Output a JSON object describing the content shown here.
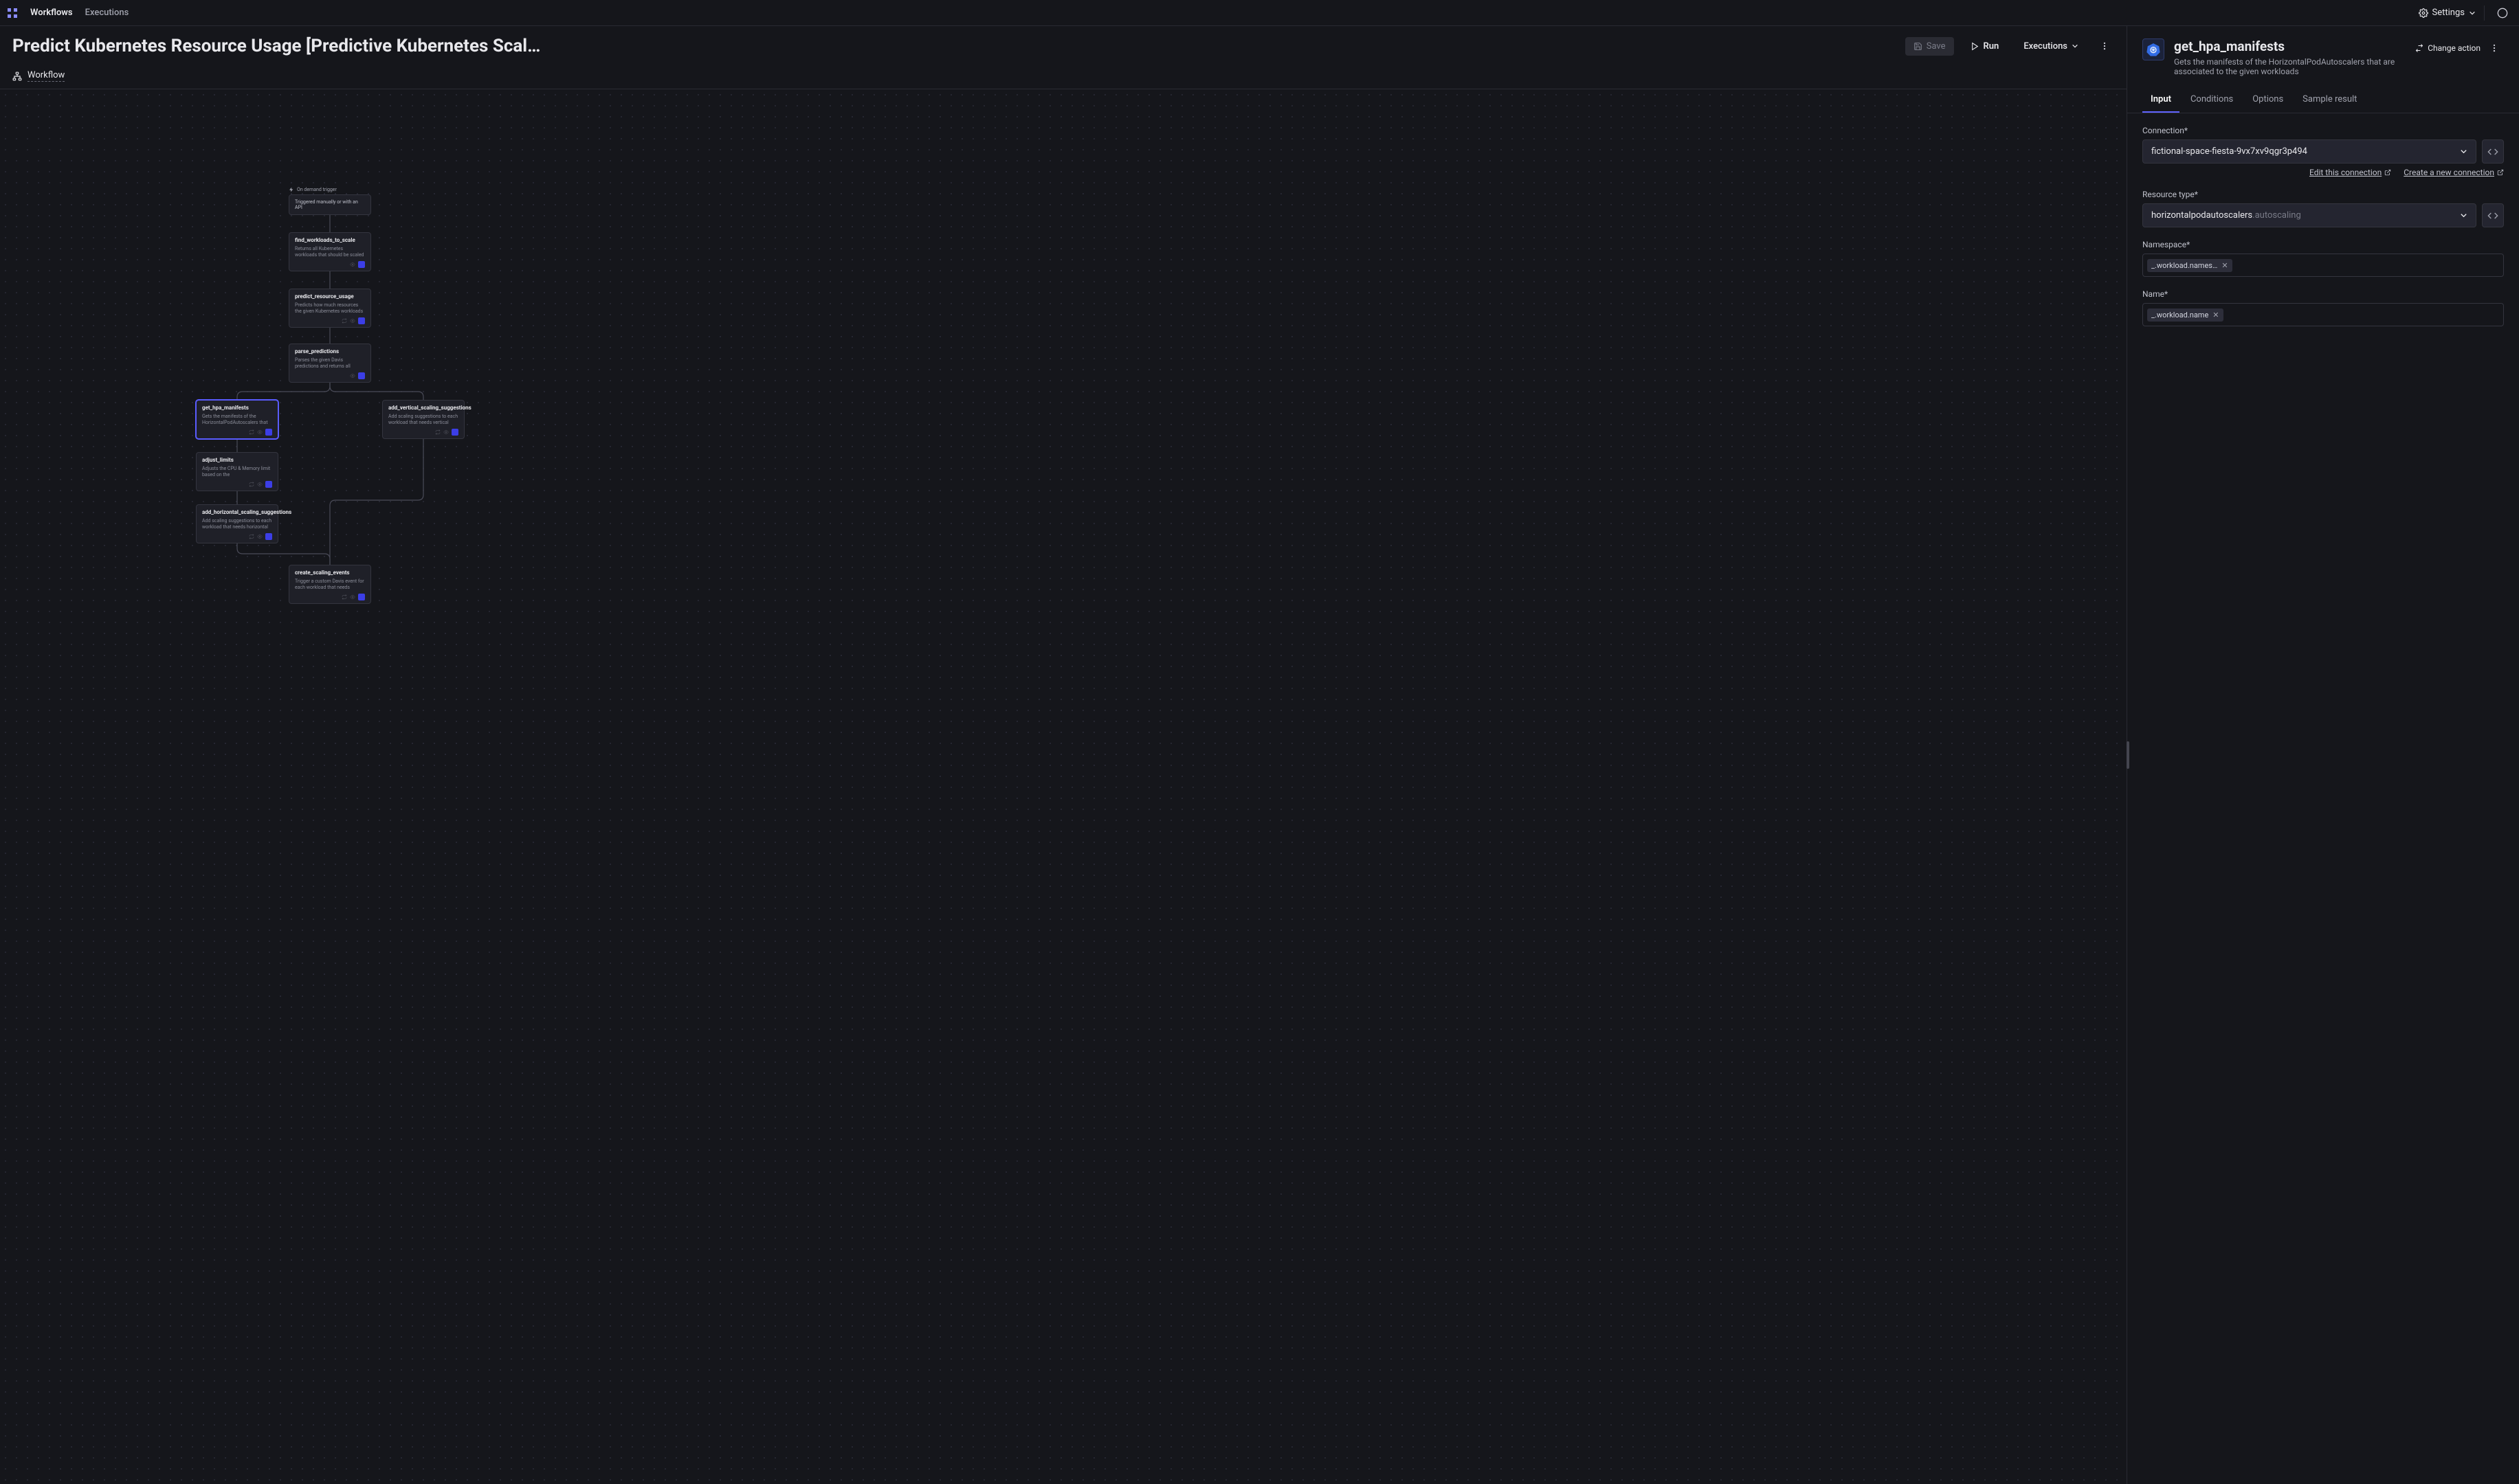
{
  "topnav": {
    "workflows": "Workflows",
    "executions": "Executions",
    "settings": "Settings"
  },
  "canvas": {
    "title": "Predict Kubernetes Resource Usage [Predictive Kubernetes Scal…",
    "save": "Save",
    "run": "Run",
    "executions": "Executions",
    "workflow_label": "Workflow"
  },
  "trigger": {
    "label": "On demand trigger",
    "desc": "Triggered manually or with an API"
  },
  "nodes": {
    "find": {
      "title": "find_workloads_to_scale",
      "desc": "Returns all Kubernetes workloads that should be scaled based on Davis…"
    },
    "predict": {
      "title": "predict_resource_usage",
      "desc": "Predicts how much resources the given Kubernetes workloads will need"
    },
    "parse": {
      "title": "parse_predictions",
      "desc": "Parses the given Davis predictions and returns all workloads that need…"
    },
    "gethpa": {
      "title": "get_hpa_manifests",
      "desc": "Gets the manifests of the HorizontalPodAutoscalers that are…"
    },
    "addvert": {
      "title": "add_vertical_scaling_suggestions",
      "desc": "Add scaling suggestions to each workload that needs vertical scaling"
    },
    "adjust": {
      "title": "adjust_limits",
      "desc": "Adjusts the CPU & Memory limit based on the HorizontalPodAutoscaler…"
    },
    "addhoriz": {
      "title": "add_horizontal_scaling_suggestions",
      "desc": "Add scaling suggestions to each workload that needs horizontal scaling"
    },
    "create": {
      "title": "create_scaling_events",
      "desc": "Trigger a custom Davis event for each workload that needs scaling and let…"
    }
  },
  "side": {
    "title": "get_hpa_manifests",
    "desc": "Gets the manifests of the HorizontalPodAutoscalers that are associated to the given workloads",
    "change_action": "Change action",
    "tabs": {
      "input": "Input",
      "conditions": "Conditions",
      "options": "Options",
      "sample": "Sample result"
    },
    "fields": {
      "connection_label": "Connection*",
      "connection_value": "fictional-space-fiesta-9vx7xv9qgr3p494",
      "edit_conn": "Edit this connection",
      "new_conn": "Create a new connection",
      "restype_label": "Resource type*",
      "restype_main": "horizontalpodautoscalers",
      "restype_suffix": ".autoscaling",
      "namespace_label": "Namespace*",
      "namespace_chip": "_.workload.names…",
      "name_label": "Name*",
      "name_chip": "_.workload.name"
    }
  }
}
